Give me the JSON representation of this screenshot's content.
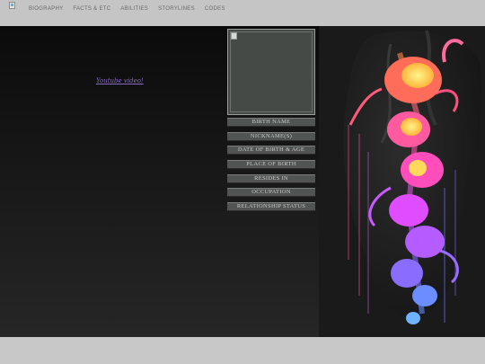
{
  "nav": {
    "items": [
      "BIOGRAPHY",
      "FACTS & ETC",
      "ABILITIES",
      "STORYLINES",
      "CODES"
    ]
  },
  "content": {
    "video_link": "Youtube video!"
  },
  "profile": {
    "fields": [
      "BIRTH NAME",
      "NICKNAME(S)",
      "DATE OF BIRTH & AGE",
      "PLACE OF BIRTH",
      "RESIDES IN",
      "OCCUPATION",
      "RELATIONSHIP STATUS"
    ]
  },
  "colors": {
    "nav_bg": "#c5c5c5",
    "page_bg": "#161616",
    "link": "#8a6bc0",
    "field_bg": "#505452"
  }
}
